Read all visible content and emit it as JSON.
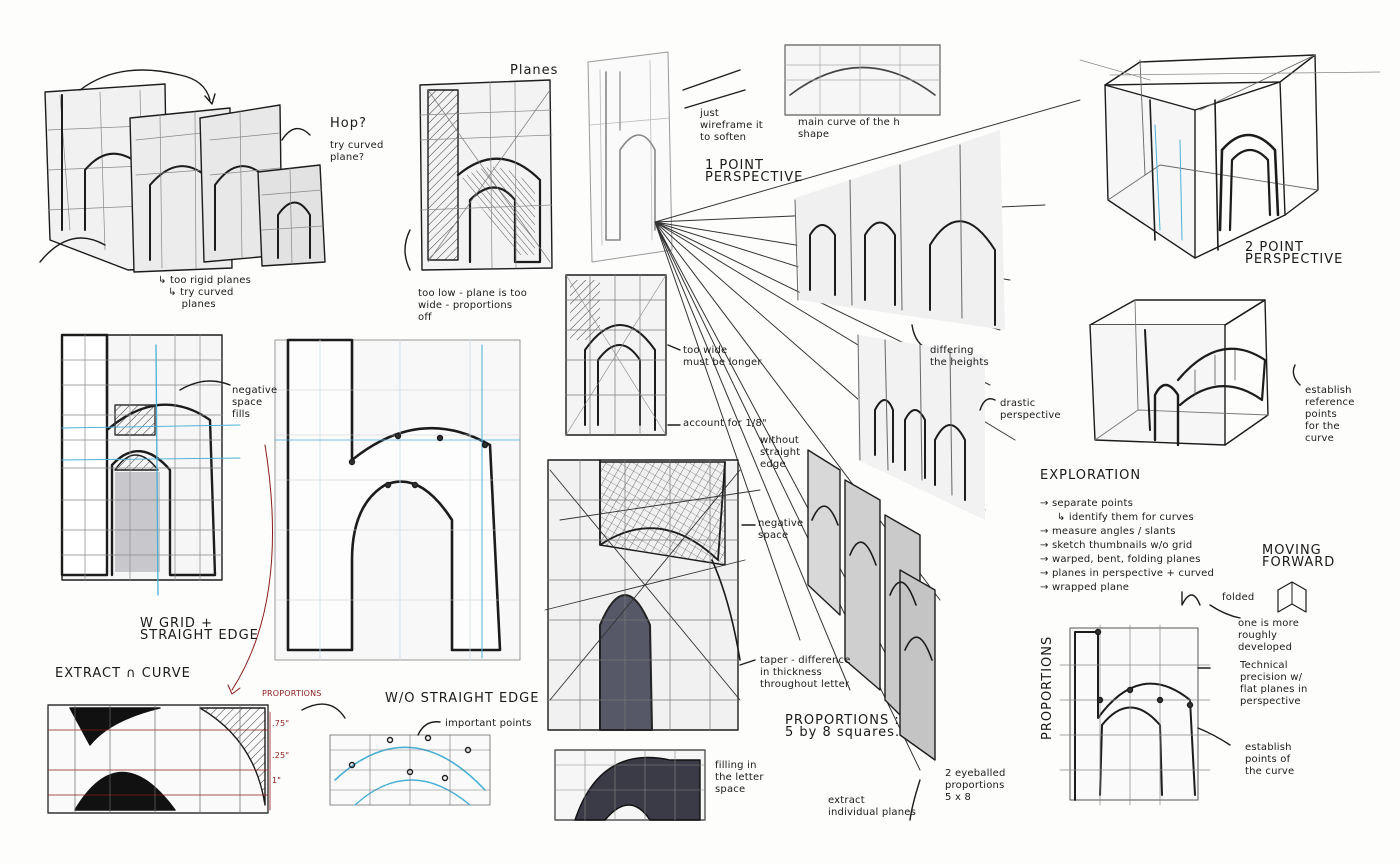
{
  "notes": {
    "hop": "Hop?",
    "try_curved_plane": "try curved\nplane?",
    "too_rigid": "↳ too rigid planes\n   ↳ try curved\n       planes",
    "planes": "Planes",
    "too_low_plane": "too low - plane is too\nwide - proportions\noff",
    "just_wireframe": "just\nwireframe it\nto soften",
    "main_curve": "main curve of the h\nshape",
    "one_point": "1 POINT\nPERSPECTIVE",
    "two_point": "2 POINT\nPERSPECTIVE",
    "too_wide": "too wide\nmust be longer",
    "account_for": "account for 1/8\"",
    "differing_heights": "differing\nthe heights",
    "drastic_perspective": "drastic\nperspective",
    "establish_reference": "establish\nreference\npoints\nfor the\ncurve",
    "negative_space_fills": "negative\nspace\nfills",
    "without_straight_edge": "without\nstraight\nedge",
    "negative_space": "negative\nspace",
    "w_grid": "W GRID +\nSTRAIGHT EDGE",
    "extract_curve": "EXTRACT ∩ CURVE",
    "proportions_red": "PROPORTIONS",
    "wo_straight_edge": "W/O STRAIGHT EDGE",
    "important_points": "important points",
    "taper": "taper - difference\nin thickness\nthroughout letter",
    "proportions_5by8": "PROPORTIONS :\n5 by 8 squares.",
    "filling": "filling in\nthe letter\nspace",
    "extract_planes": "extract\nindividual planes",
    "eyeballed": "2 eyeballed\nproportions\n5 x 8",
    "exploration": "EXPLORATION",
    "exploration_list": "→ separate points\n     ↳ identify them for curves\n→ measure angles / slants\n→ sketch thumbnails w/o grid\n→ warped, bent, folding planes\n→ planes in perspective + curved\n→ wrapped plane",
    "folded": "folded",
    "moving_forward": "MOVING\nFORWARD",
    "one_is_more": "one is more\nroughly\ndeveloped",
    "proportions_vertical": "PROPORTIONS",
    "technical_precision": "Technical\nprecision w/\nflat planes in\nperspective",
    "establish_points": "establish\npoints of\nthe curve",
    "ratio_top": ".75\"",
    "ratio_mid": ".25\"",
    "ratio_bottom": "1\""
  }
}
